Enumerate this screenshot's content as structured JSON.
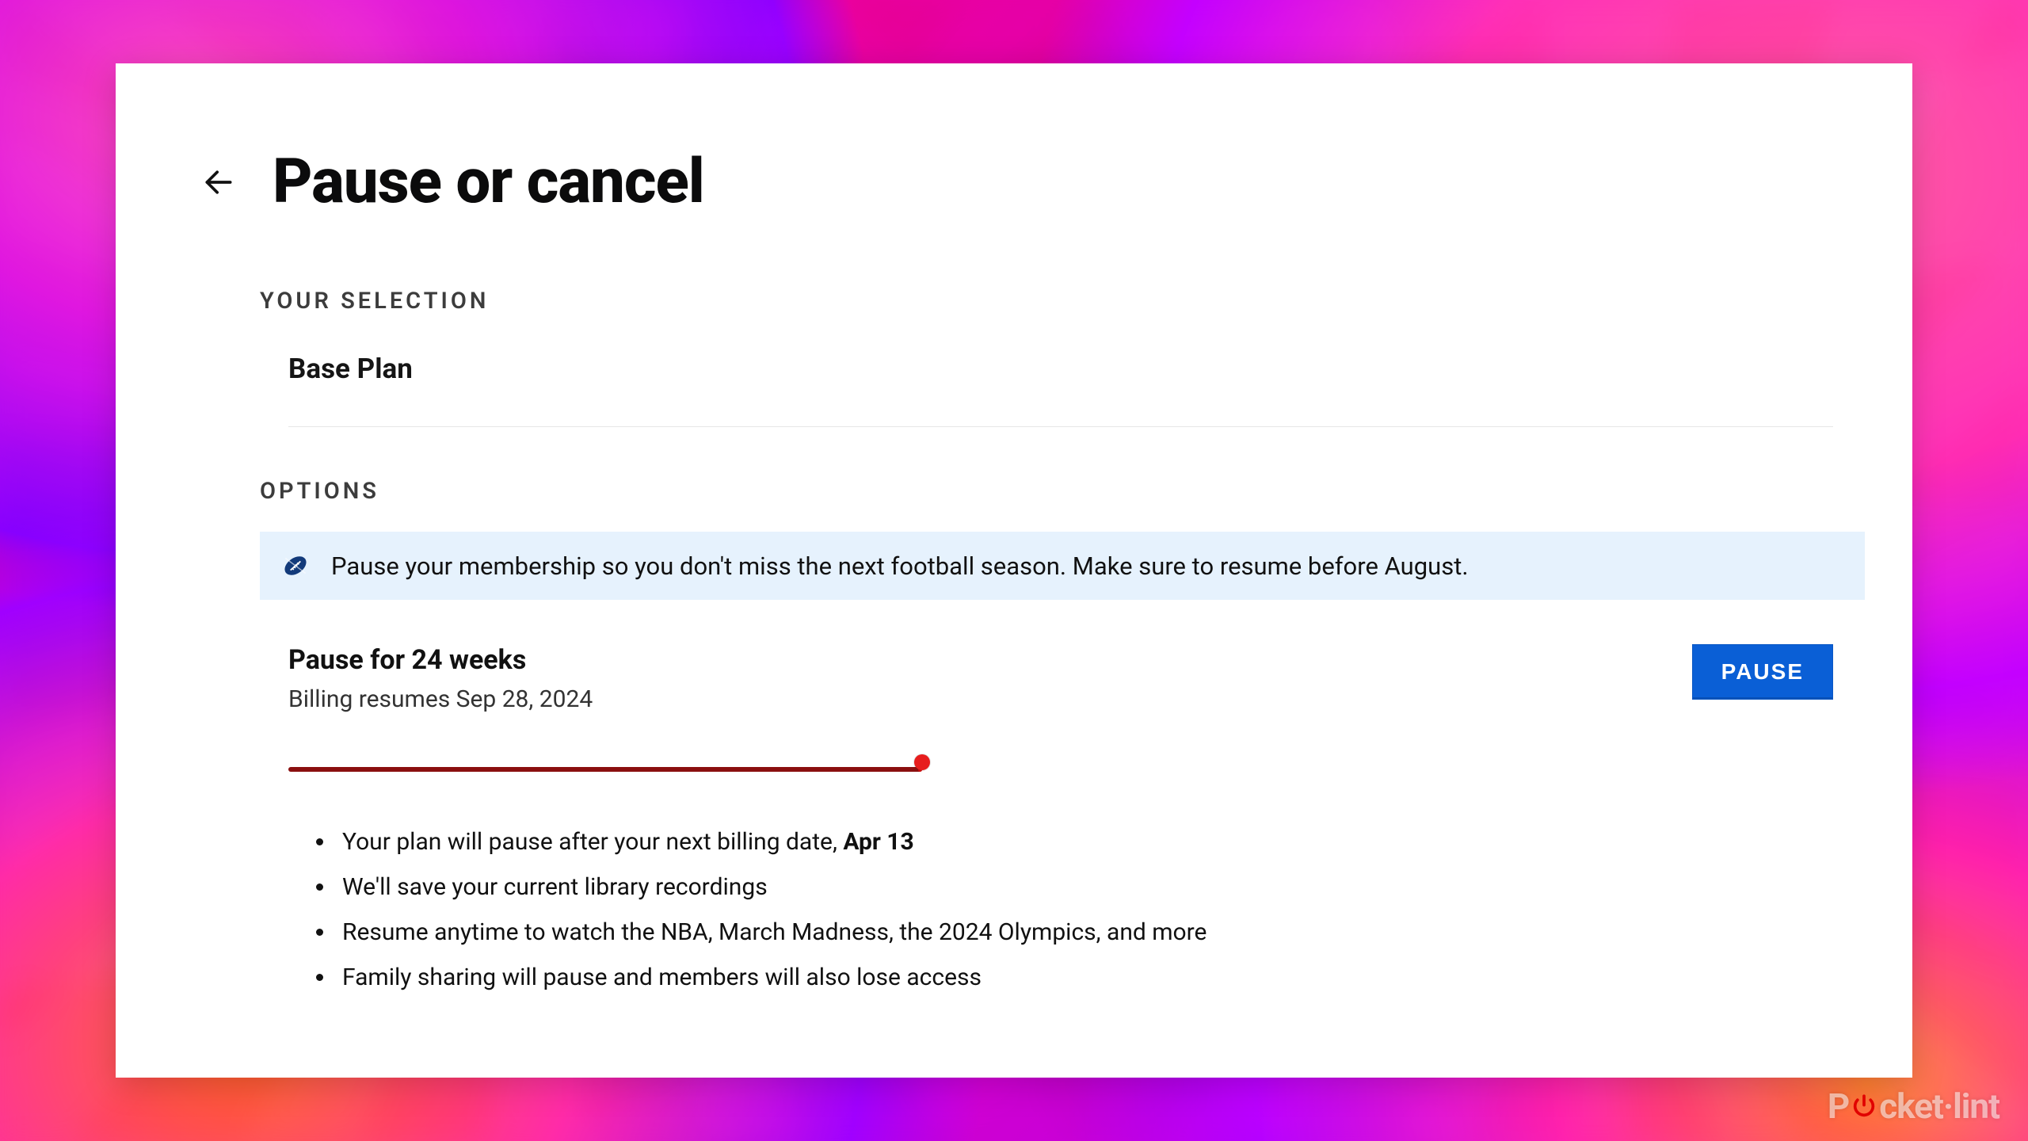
{
  "header": {
    "title": "Pause or cancel"
  },
  "selection": {
    "label": "YOUR SELECTION",
    "plan": "Base Plan"
  },
  "options": {
    "label": "OPTIONS",
    "banner_text": "Pause your membership so you don't miss the next football season. Make sure to resume before August."
  },
  "pause": {
    "title": "Pause for 24 weeks",
    "subtitle": "Billing resumes Sep 28, 2024",
    "button_label": "PAUSE",
    "slider_value": 24,
    "slider_max": 24
  },
  "bullets": {
    "item1_pre": "Your plan will pause after your next billing date, ",
    "item1_bold": "Apr 13",
    "item2": "We'll save your current library recordings",
    "item3": "Resume anytime to watch the NBA, March Madness, the 2024 Olympics, and more",
    "item4": "Family sharing will pause and members will also lose access"
  },
  "watermark": {
    "prefix": "P",
    "suffix": "cket·lint"
  }
}
